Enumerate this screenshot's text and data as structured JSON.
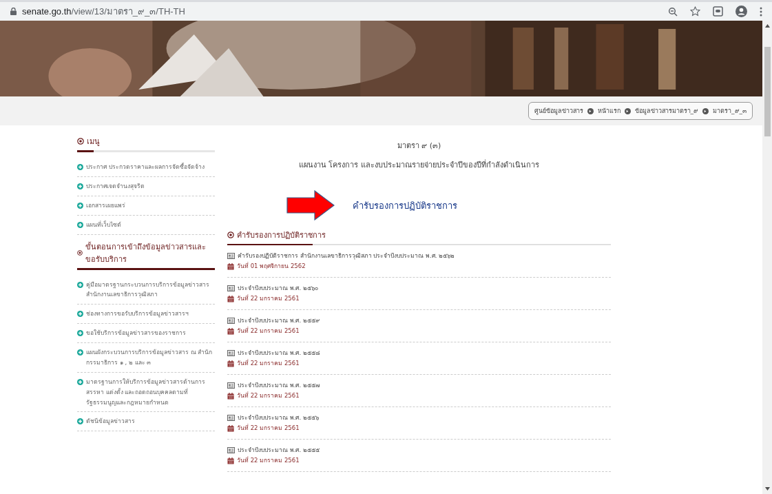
{
  "address_bar": {
    "host": "senate.go.th",
    "path": "/view/13/มาตรา_๙_๓/TH-TH"
  },
  "breadcrumb": [
    "ศูนย์ข้อมูลข่าวสาร",
    "หน้าแรก",
    "ข้อมูลข่าวสารมาตรา_๙",
    "มาตรา_๙_๓"
  ],
  "sidebar": {
    "sections": [
      {
        "title": "เมนู",
        "items": [
          "ประกาศ ประกวดราคาและผลการจัดซื้อจัดจ้าง",
          "ประกาศเจตจำนงสุจริต",
          "เอกสารเผยแพร่",
          "แผนที่เว็บไซต์"
        ]
      },
      {
        "title": "ขั้นตอนการเข้าถึงข้อมูลข่าวสารและขอรับบริการ",
        "items": [
          "คู่มือมาตรฐานกระบวนการบริการข้อมูลข่าวสาร สำนักงานเลขาธิการวุฒิสภา",
          "ช่องทางการขอรับบริการข้อมูลข่าวสารฯ",
          "ขอใช้บริการข้อมูลข่าวสารของราชการ",
          "แผนผังกระบวนการบริการข้อมูลข่าวสาร ณ สำนักกรรมาธิการ ๑ , ๒ และ ๓",
          "มาตรฐานการให้บริการข้อมูลข่าวสารด้านการสรรหา แต่งตั้ง และถอดถอนบุคคลตามที่รัฐธรรมนูญและกฎหมายกำหนด",
          "ดัชนีข้อมูลข่าวสาร"
        ]
      }
    ]
  },
  "main": {
    "heading": "มาตรา ๙ (๓)",
    "subtitle": "แผนงาน โครงการ และงบประมาณรายจ่ายประจำปีของปีที่กำลังดำเนินการ",
    "link": "คำรับรองการปฏิบัติราชการ",
    "section_title": "คำรับรองการปฏิบัติราชการ",
    "documents": [
      {
        "title": "คำรับรองปฏิบัติราชการ สำนักงานเลขาธิการวุฒิสภา ประจำปีงบประมาณ พ.ศ. ๒๕๖๒",
        "date": "วันที่ 01 พฤศจิกายน 2562"
      },
      {
        "title": "ประจำปีงบประมาณ พ.ศ. ๒๕๖๐",
        "date": "วันที่ 22 มกราคม 2561"
      },
      {
        "title": "ประจำปีงบประมาณ พ.ศ. ๒๕๕๙",
        "date": "วันที่ 22 มกราคม 2561"
      },
      {
        "title": "ประจำปีงบประมาณ พ.ศ. ๒๕๕๘",
        "date": "วันที่ 22 มกราคม 2561"
      },
      {
        "title": "ประจำปีงบประมาณ พ.ศ. ๒๕๕๗",
        "date": "วันที่ 22 มกราคม 2561"
      },
      {
        "title": "ประจำปีงบประมาณ พ.ศ. ๒๕๕๖",
        "date": "วันที่ 22 มกราคม 2561"
      },
      {
        "title": "ประจำปีงบประมาณ พ.ศ. ๒๕๕๕",
        "date": "วันที่ 22 มกราคม 2561"
      }
    ]
  }
}
